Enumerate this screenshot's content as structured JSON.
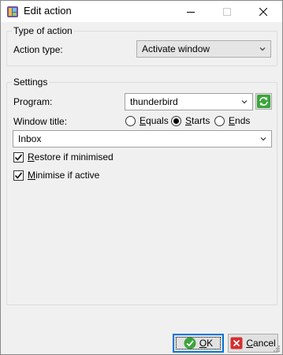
{
  "window": {
    "title": "Edit action",
    "minimize_icon": "minimize-icon",
    "maximize_icon": "maximize-icon",
    "close_icon": "close-icon"
  },
  "type_group": {
    "legend": "Type of action",
    "action_type_label": "Action type:",
    "action_type_value": "Activate window"
  },
  "settings_group": {
    "legend": "Settings",
    "program_label": "Program:",
    "program_value": "thunderbird",
    "window_title_label": "Window title:",
    "match_options": [
      {
        "label_prefix": "",
        "mnemonic": "E",
        "label_rest": "quals",
        "selected": false
      },
      {
        "label_prefix": "",
        "mnemonic": "S",
        "label_rest": "tarts",
        "selected": true
      },
      {
        "label_prefix": "",
        "mnemonic": "E",
        "label_rest": "nds",
        "selected": false
      }
    ],
    "window_title_value": "Inbox",
    "restore_checkbox": {
      "mnemonic": "R",
      "label_rest": "estore if minimised",
      "checked": true
    },
    "minimise_checkbox": {
      "mnemonic": "M",
      "label_rest": "inimise if active",
      "checked": true
    }
  },
  "buttons": {
    "ok": {
      "mnemonic": "O",
      "label_rest": "K"
    },
    "cancel": {
      "mnemonic": "C",
      "label_rest": "ancel"
    }
  },
  "colors": {
    "accent": "#0078d7",
    "ok_icon": "#3aa53a",
    "cancel_icon": "#d32f2f",
    "refresh_icon": "#3aa53a"
  }
}
